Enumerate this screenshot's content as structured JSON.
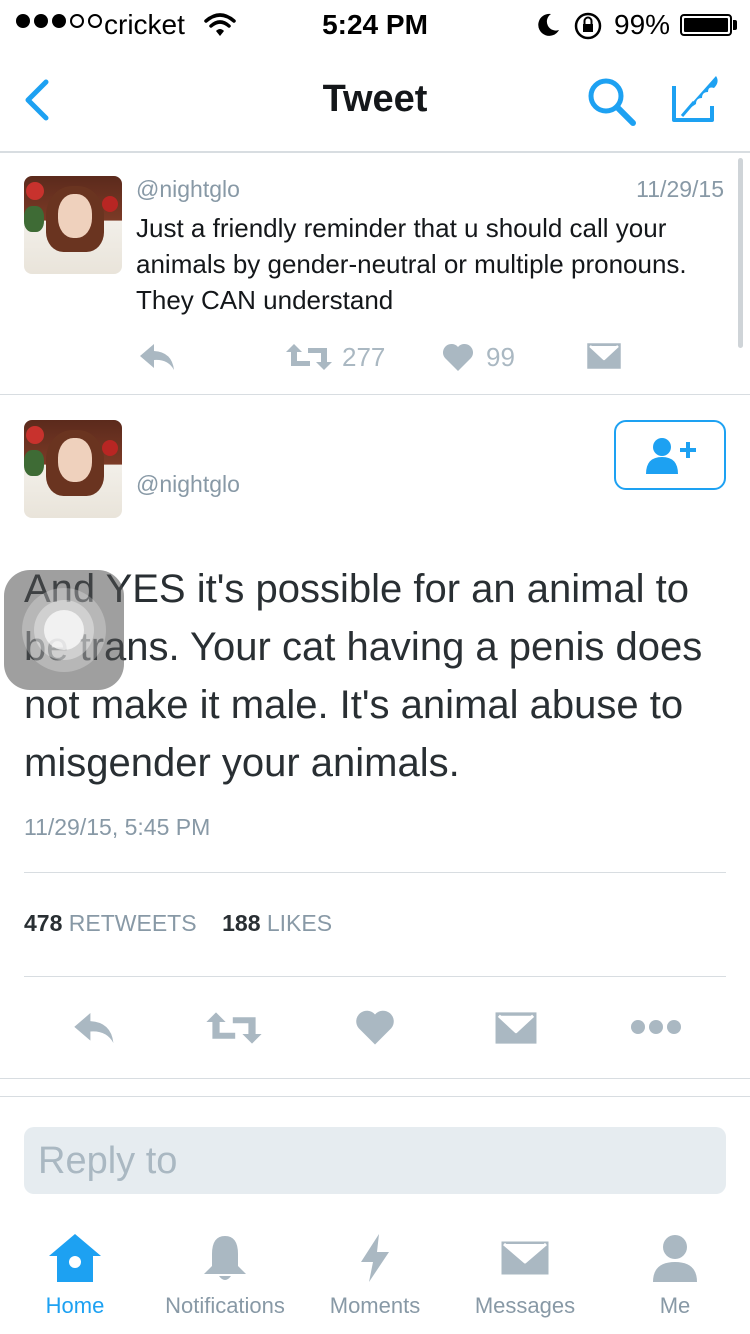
{
  "status_bar": {
    "carrier": "cricket",
    "time": "5:24 PM",
    "battery_percent": "99%",
    "battery_level": 0.99
  },
  "nav": {
    "title": "Tweet",
    "icons": [
      "back-chevron-icon",
      "search-icon",
      "compose-icon"
    ]
  },
  "previous_tweet": {
    "handle": "@nightglo",
    "date": "11/29/15",
    "text": "Just a friendly reminder that u should call your animals by gender-neutral or multiple pronouns. They CAN understand",
    "retweets": "277",
    "likes": "99"
  },
  "main_tweet": {
    "handle": "@nightglo",
    "text": "And YES it's possible for an animal to be trans. Your cat having a penis does not make it male. It's animal abuse to misgender your animals.",
    "timestamp": "11/29/15, 5:45 PM",
    "retweet_count": "478",
    "retweet_label": "RETWEETS",
    "like_count": "188",
    "like_label": "LIKES"
  },
  "reply": {
    "placeholder": "Reply to"
  },
  "tab_bar": {
    "home": "Home",
    "notifications": "Notifications",
    "moments": "Moments",
    "messages": "Messages",
    "me": "Me"
  },
  "colors": {
    "accent": "#1da1f2",
    "muted": "#8899a6",
    "icon_gray": "#aab8c2"
  }
}
